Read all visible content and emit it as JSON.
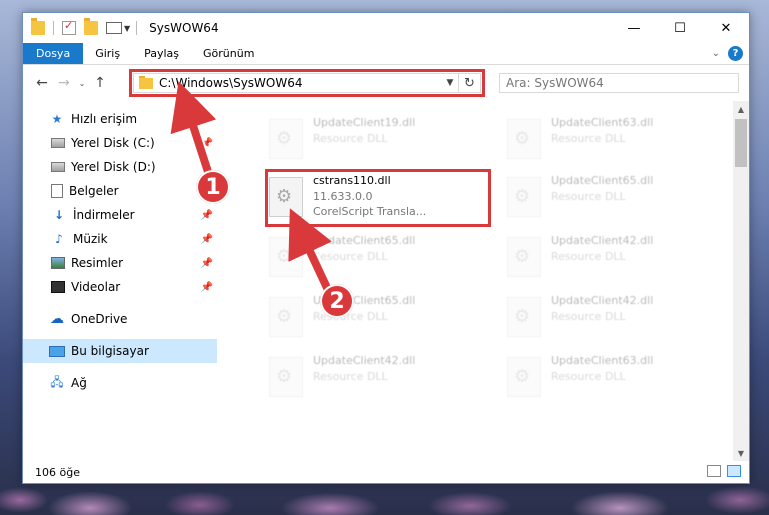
{
  "window": {
    "title": "SysWOW64",
    "controls": {
      "minimize": "—",
      "maximize": "☐",
      "close": "✕"
    }
  },
  "ribbon": {
    "tabs": [
      "Dosya",
      "Giriş",
      "Paylaş",
      "Görünüm"
    ],
    "help": "?"
  },
  "navbar": {
    "back": "←",
    "forward": "→",
    "recent": "⌄",
    "up": "↑",
    "address": "C:\\Windows\\SysWOW64",
    "refresh": "↻",
    "search_placeholder": "Ara: SysWOW64"
  },
  "sidebar": {
    "quick_access": "Hızlı erişim",
    "items": [
      {
        "label": "Yerel Disk (C:)"
      },
      {
        "label": "Yerel Disk (D:)"
      },
      {
        "label": "Belgeler"
      },
      {
        "label": "İndirmeler"
      },
      {
        "label": "Müzik"
      },
      {
        "label": "Resimler"
      },
      {
        "label": "Videolar"
      }
    ],
    "onedrive": "OneDrive",
    "this_pc": "Bu bilgisayar",
    "network": "Ağ"
  },
  "files": {
    "focused": {
      "name": "cstrans110.dll",
      "version": "11.633.0.0",
      "description": "CorelScript Transla..."
    },
    "faded": [
      {
        "name": "UpdateClient19.dll",
        "type": "Resource DLL"
      },
      {
        "name": "UpdateClient63.dll",
        "type": "Resource DLL"
      },
      {
        "name": "UpdateClient65.dll",
        "type": "Resource DLL"
      },
      {
        "name": "UpdateClient65.dll",
        "type": "Resource DLL"
      },
      {
        "name": "UpdateClient42.dll",
        "type": "Resource DLL"
      },
      {
        "name": "UpdateClient65.dll",
        "type": "Resource DLL"
      },
      {
        "name": "UpdateClient42.dll",
        "type": "Resource DLL"
      },
      {
        "name": "UpdateClient42.dll",
        "type": "Resource DLL"
      },
      {
        "name": "UpdateClient63.dll",
        "type": "Resource DLL"
      }
    ]
  },
  "status": {
    "count": "106 öğe"
  },
  "callouts": {
    "one": "1",
    "two": "2"
  },
  "colors": {
    "accent": "#1979ca",
    "highlight": "#d9393a",
    "selected": "#cce8ff"
  }
}
